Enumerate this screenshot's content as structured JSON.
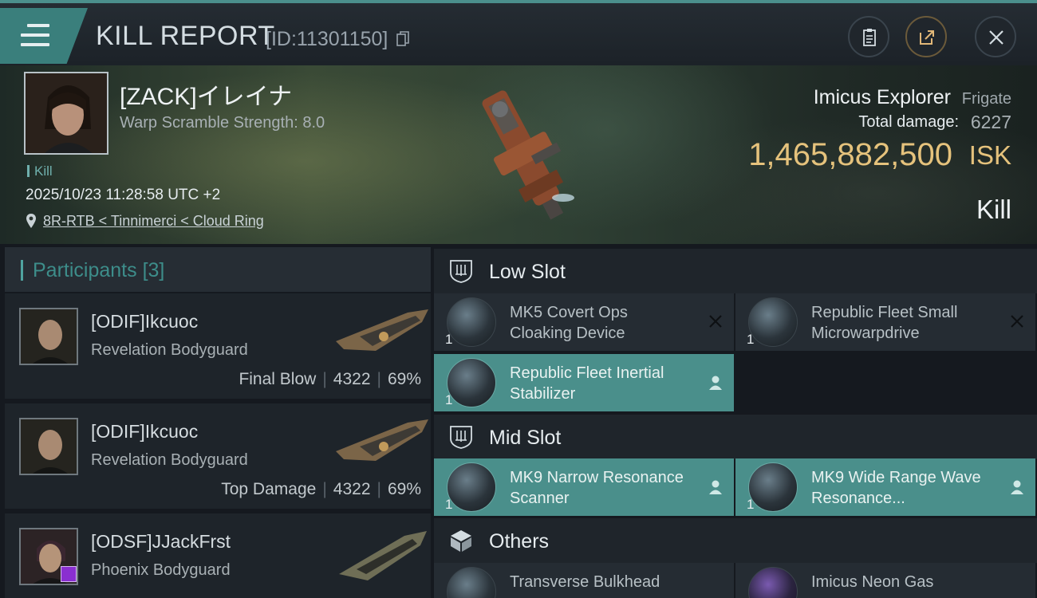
{
  "header": {
    "title": "KILL REPORT",
    "report_id": "[ID:11301150]"
  },
  "victim": {
    "name": "[ZACK]イレイナ",
    "warp_scramble": "Warp Scramble Strength: 8.0",
    "kill_tag": "Kill",
    "datetime": "2025/10/23 11:28:58 UTC +2",
    "location": "8R-RTB < Tinnimerci < Cloud Ring",
    "ship_name": "Imicus Explorer",
    "ship_class": "Frigate",
    "damage_label": "Total damage:",
    "damage_value": "6227",
    "isk_value": "1,465,882,500",
    "isk_unit": "ISK",
    "result": "Kill"
  },
  "participants": {
    "title": "Participants",
    "count": "[3]",
    "rows": [
      {
        "name": "[ODIF]Ikcuoc",
        "ship": "Revelation Bodyguard",
        "label": "Final Blow",
        "damage": "4322",
        "percent": "69%"
      },
      {
        "name": "[ODIF]Ikcuoc",
        "ship": "Revelation Bodyguard",
        "label": "Top Damage",
        "damage": "4322",
        "percent": "69%"
      },
      {
        "name": "[ODSF]JJackFrst",
        "ship": "Phoenix Bodyguard"
      }
    ]
  },
  "slots": {
    "low": {
      "label": "Low Slot",
      "items": [
        {
          "name": "MK5 Covert Ops Cloaking Device",
          "qty": "1",
          "status": "destroyed"
        },
        {
          "name": "Republic Fleet Small Microwarpdrive",
          "qty": "1",
          "status": "destroyed"
        },
        {
          "name": "Republic Fleet Inertial Stabilizer",
          "qty": "1",
          "status": "dropped"
        }
      ]
    },
    "mid": {
      "label": "Mid Slot",
      "items": [
        {
          "name": "MK9 Narrow Resonance Scanner",
          "qty": "1",
          "status": "dropped"
        },
        {
          "name": "MK9 Wide Range Wave Resonance...",
          "qty": "1",
          "status": "dropped"
        }
      ]
    },
    "others": {
      "label": "Others",
      "items": [
        {
          "name": "Transverse Bulkhead"
        },
        {
          "name": "Imicus Neon Gas"
        }
      ]
    }
  },
  "colors": {
    "accent": "#4a8f8b",
    "isk_gold": "#e5c27c",
    "panel": "#252c33"
  },
  "icons": [
    "menu-icon",
    "copy-icon",
    "clipboard-icon",
    "share-icon",
    "close-icon",
    "location-pin-icon",
    "low-slot-icon",
    "mid-slot-icon",
    "cube-icon",
    "destroyed-x-icon",
    "dropped-person-icon"
  ]
}
